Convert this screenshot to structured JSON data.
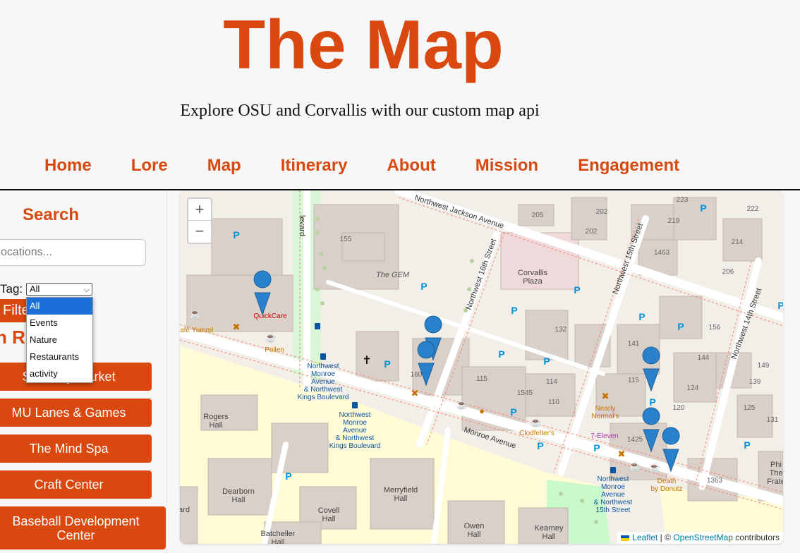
{
  "header": {
    "title": "The Map",
    "subtitle": "Explore OSU and Corvallis with our custom map api"
  },
  "nav": {
    "items": [
      "Home",
      "Lore",
      "Map",
      "Itinerary",
      "About",
      "Mission",
      "Engagement"
    ]
  },
  "sidebar": {
    "search_title": "Search",
    "search_placeholder": "ocations...",
    "tag_label": "Tag:",
    "tag_selected": "All",
    "tag_options": [
      "All",
      "Events",
      "Nature",
      "Restaurants",
      "activity"
    ],
    "filter_label": "Filte",
    "recs_title": "n Re",
    "recommendations": [
      "Saturday Market",
      "MU Lanes & Games",
      "The Mind Spa",
      "Craft Center",
      "Baseball Development Center"
    ]
  },
  "map": {
    "zoom_in": "+",
    "zoom_out": "−",
    "attribution": {
      "leaflet": "Leaflet",
      "separator": "| ©",
      "osm": "OpenStreetMap",
      "contributors": "contributors"
    },
    "labels": {
      "nw_jackson": "Northwest Jackson Avenue",
      "nw_16th": "Northwest 16th Street",
      "nw_15th": "Northwest 15th Street",
      "nw_14th": "Northwest 14th Street",
      "monroe": "Monroe Avenue",
      "boulevard": "levard",
      "the_gem": "The GEM",
      "corvallis_plaza_1": "Corvallis",
      "corvallis_plaza_2": "Plaza",
      "quickcare": "QuickCare",
      "cafe_yumm": "afé Yumm!",
      "pollen": "Pollen",
      "nearly_normals_1": "Nearly",
      "nearly_normals_2": "Normal's",
      "seven_eleven": "7-Eleven",
      "clodfelters": "Clodfelter's",
      "death_donutz_1": "Death",
      "death_donutz_2": "by Donutz",
      "rogers_1": "Rogers",
      "rogers_2": "Hall",
      "dearborn_1": "Dearborn",
      "dearborn_2": "Hall",
      "merryfield_1": "Merryfield",
      "merryfield_2": "Hall",
      "covell_1": "Covell",
      "covell_2": "Hall",
      "owen_1": "Owen",
      "owen_2": "Hall",
      "kearney_1": "Kearney",
      "kearney_2": "Hall",
      "batcheller_1": "Batcheller",
      "batcheller_2": "Hall",
      "ard": "ard",
      "phi_1": "Phi",
      "phi_2": "The",
      "phi_3": "Frate",
      "stop1_1": "Northwest",
      "stop1_2": "Monroe",
      "stop1_3": "Avenue",
      "stop1_4": "& Northwest",
      "stop1_5": "Kings Boulevard",
      "stop2_1": "Northwest",
      "stop2_2": "Monroe",
      "stop2_3": "Avenue",
      "stop2_4": "& Northwest",
      "stop2_5": "Kings Boulevard",
      "stop3_1": "Northwest",
      "stop3_2": "Monroe",
      "stop3_3": "Avenue",
      "stop3_4": "& Northwest",
      "stop3_5": "15th Street"
    },
    "house_numbers": [
      "155",
      "205",
      "202",
      "202",
      "223",
      "219",
      "222",
      "214",
      "1463",
      "206",
      "132",
      "141",
      "156",
      "144",
      "149",
      "139",
      "115",
      "1545",
      "114",
      "110",
      "115",
      "124",
      "120",
      "125",
      "131",
      "1425",
      "1363",
      "160"
    ],
    "parking": "P",
    "colors": {
      "accent": "#d9480f",
      "marker": "#2a81cb",
      "road": "#ffffff",
      "building": "#d9d0c9",
      "park": "#c8facc",
      "campus": "#fffbd6"
    }
  }
}
